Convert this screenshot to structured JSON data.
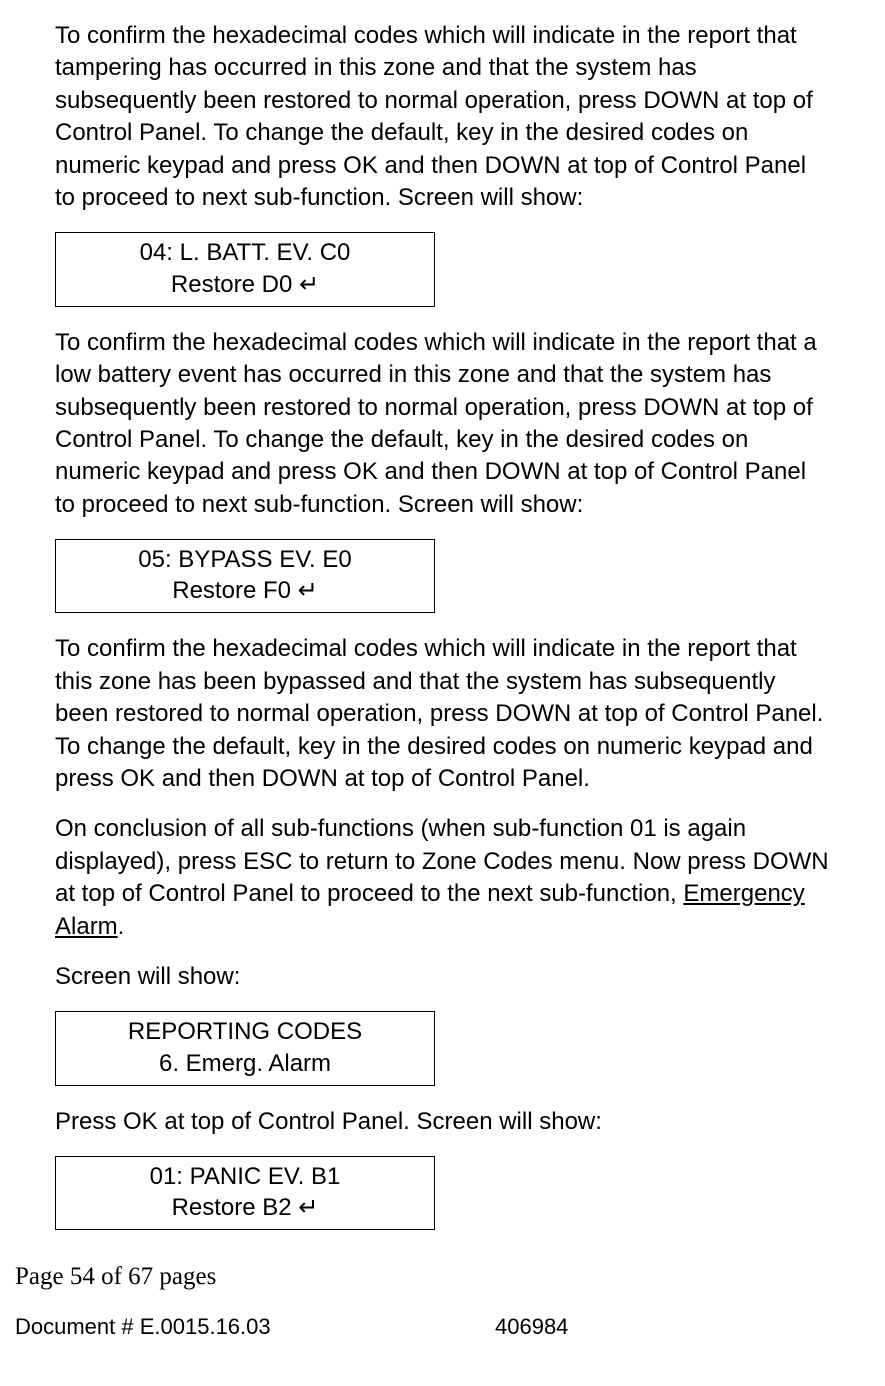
{
  "paragraphs": {
    "p1": "To confirm the hexadecimal codes which will indicate in the report that tampering has occurred in this zone and that the system has subsequently been restored to normal operation, press DOWN at top of Control Panel. To change the default, key in the desired codes on numeric keypad and press OK and then DOWN at top of Control Panel to proceed to next sub-function. Screen will show:",
    "p2": "To confirm the hexadecimal codes which will indicate in the report that a low battery event has occurred in this zone and that the system has subsequently been restored to normal operation, press DOWN at top of Control Panel. To change the default, key in the desired codes on numeric keypad and press OK and then DOWN at top of Control Panel to proceed to next sub-function. Screen will show:",
    "p3": "To confirm the hexadecimal codes which will indicate in the report that this zone has been bypassed and that the system has subsequently been restored to normal operation, press DOWN at top of Control Panel. To change the default, key in the desired codes on numeric keypad and press OK and then DOWN at top of Control Panel.",
    "p4a": "On conclusion of all sub-functions (when sub-function 01 is again displayed), press ESC to return to Zone Codes menu. Now press DOWN at top of Control Panel to proceed to the next sub-function, ",
    "p4b_underlined": "Emergency Alarm",
    "p4c": ".",
    "p5": "Screen will show:",
    "p6": "Press OK at top of Control Panel. Screen will show:"
  },
  "screens": {
    "s1_line1": "04: L. BATT. EV. C0",
    "s1_line2": "Restore D0    ↵",
    "s2_line1": "05: BYPASS EV. E0",
    "s2_line2": "Restore F0    ↵",
    "s3_line1": "REPORTING CODES",
    "s3_line2": "6. Emerg. Alarm",
    "s4_line1": "01: PANIC EV. B1",
    "s4_line2": "Restore B2    ↵"
  },
  "footer": {
    "page": "Page 54 of  67 pages",
    "doc": "Document # E.0015.16.03",
    "code": "406984"
  }
}
